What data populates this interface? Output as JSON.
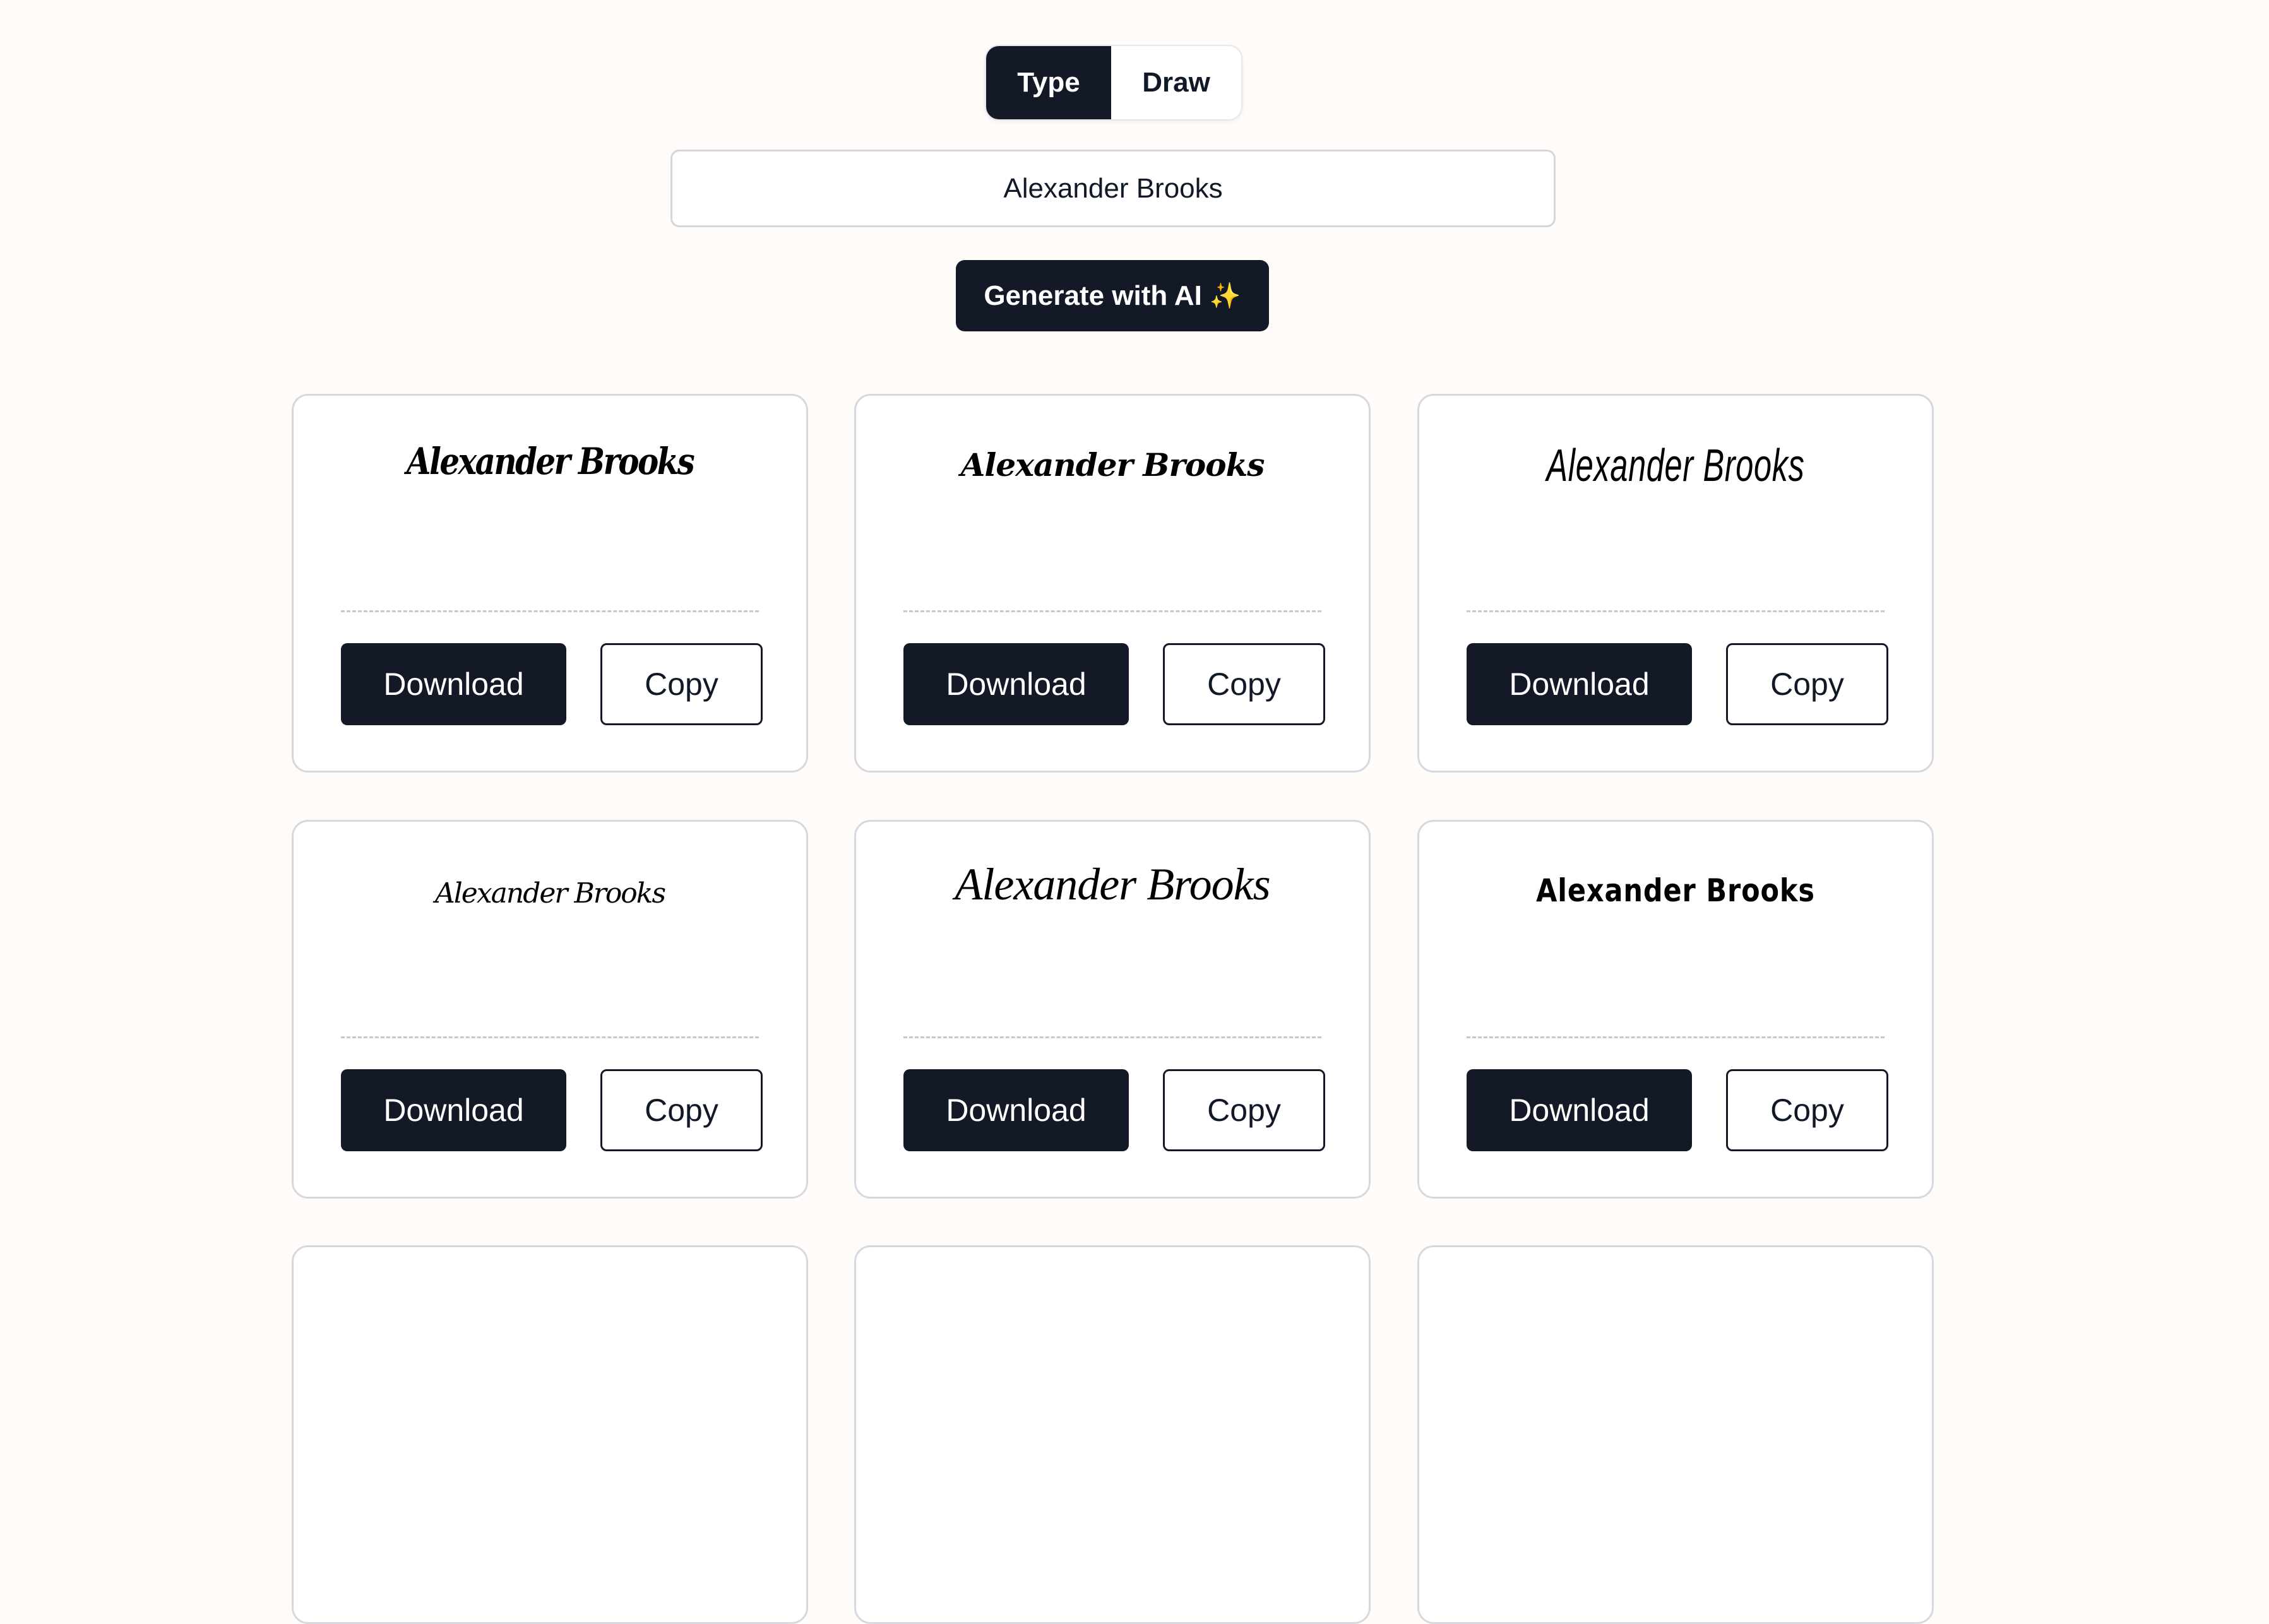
{
  "mode_toggle": {
    "tabs": [
      {
        "label": "Type",
        "active": true
      },
      {
        "label": "Draw",
        "active": false
      }
    ]
  },
  "name_input": {
    "value": "Alexander Brooks",
    "placeholder": ""
  },
  "generate_button": {
    "label": "Generate with AI",
    "icon": "sparkles-icon",
    "icon_glyph": "✨"
  },
  "cards": [
    {
      "signature": "Alexander Brooks",
      "style": "brush-outline",
      "download_label": "Download",
      "copy_label": "Copy"
    },
    {
      "signature": "Alexander Brooks",
      "style": "bold-calligraphy",
      "download_label": "Download",
      "copy_label": "Copy"
    },
    {
      "signature": "Alexander Brooks",
      "style": "condensed-hand",
      "download_label": "Download",
      "copy_label": "Copy"
    },
    {
      "signature": "Alexander Brooks",
      "style": "small-italic-script",
      "download_label": "Download",
      "copy_label": "Copy"
    },
    {
      "signature": "Alexander Brooks",
      "style": "flowing-script",
      "download_label": "Download",
      "copy_label": "Copy"
    },
    {
      "signature": "Alexander Brooks",
      "style": "bold-marker",
      "download_label": "Download",
      "copy_label": "Copy"
    }
  ],
  "colors": {
    "background": "#fefbf8",
    "primary": "#141927",
    "card_border": "#d6d8de",
    "sparkle": "#f6c945"
  }
}
